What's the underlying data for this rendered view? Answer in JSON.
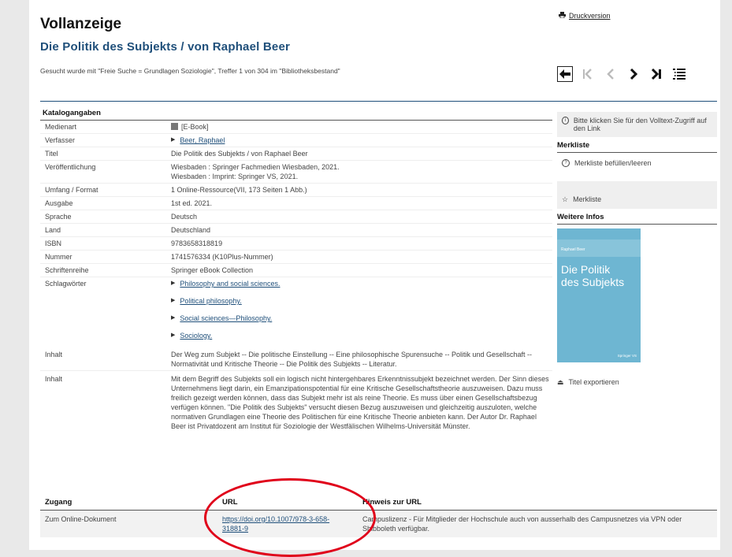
{
  "header": {
    "title": "Vollanzeige",
    "subtitle": "Die Politik des Subjekts / von Raphael Beer",
    "search_info": "Gesucht wurde mit \"Freie Suche = Grundlagen Soziologie\", Treffer 1 von 304 im \"Bibliotheksbestand\"",
    "print_label": "Druckversion"
  },
  "katalog": {
    "heading": "Katalogangaben",
    "rows": [
      {
        "key": "Medienart",
        "value": "[E-Book]"
      },
      {
        "key": "Verfasser",
        "value": "Beer, Raphael"
      },
      {
        "key": "Titel",
        "value": "Die Politik des Subjekts / von Raphael Beer"
      },
      {
        "key": "Veröffentlichung",
        "value": "Wiesbaden : Springer Fachmedien Wiesbaden, 2021.",
        "value2": "Wiesbaden : Imprint: Springer VS, 2021."
      },
      {
        "key": "Umfang / Format",
        "value": "1 Online-Ressource(VII, 173 Seiten 1 Abb.)"
      },
      {
        "key": "Ausgabe",
        "value": "1st ed. 2021."
      },
      {
        "key": "Sprache",
        "value": "Deutsch"
      },
      {
        "key": "Land",
        "value": "Deutschland"
      },
      {
        "key": "ISBN",
        "value": "9783658318819"
      },
      {
        "key": "Nummer",
        "value": "1741576334 (K10Plus-Nummer)"
      },
      {
        "key": "Schriftenreihe",
        "value": "Springer eBook Collection"
      },
      {
        "key": "Schlagwörter"
      }
    ],
    "schlagwoerter": [
      "Philosophy and social sciences.",
      "Political philosophy.",
      "Social sciences—Philosophy.",
      "Sociology."
    ],
    "inhalt_label": "Inhalt",
    "inhalt1": "Der Weg zum Subjekt -- Die politische Einstellung -- Eine philosophische Spurensuche -- Politik und Gesellschaft -- Normativität und Kritische Theorie -- Die Politik des Subjekts -- Literatur.",
    "inhalt2": "Mit dem Begriff des Subjekts soll ein logisch nicht hintergehbares Erkenntnissubjekt bezeichnet werden. Der Sinn dieses Unternehmens liegt darin, ein Emanzipationspotential für eine Kritische Gesellschaftstheorie auszuweisen. Dazu muss freilich gezeigt werden können, dass das Subjekt mehr ist als reine Theorie. Es muss über einen Gesellschaftsbezug verfügen können. \"Die Politik des Subjekts\" versucht diesen Bezug auszuweisen und gleichzeitig auszuloten, welche normativen Grundlagen eine Theorie des Politischen für eine Kritische Theorie anbieten kann. Der Autor Dr. Raphael Beer ist Privatdozent am Institut für Soziologie der Westfälischen Wilhelms-Universität Münster."
  },
  "sidebar": {
    "volltext": "Bitte klicken Sie für den Volltext-Zugriff auf den Link",
    "merkliste_heading": "Merkliste",
    "merkliste_fill": "Merkliste befüllen/leeren",
    "merkliste": "Merkliste",
    "weitere_heading": "Weitere Infos",
    "cover_author": "Raphael Beer",
    "cover_title_line1": "Die Politik",
    "cover_title_line2": "des Subjekts",
    "cover_publisher": "Springer VS",
    "export": "Titel exportieren"
  },
  "zugang": {
    "col1": "Zugang",
    "col2": "URL",
    "col3": "Hinweis zur URL",
    "row_label": "Zum Online-Dokument",
    "url_line1": "https://doi.org/10.1007/978-3-658-",
    "url_line2": "31881-9",
    "hinweis": "Campuslizenz - Für Mitglieder der Hochschule auch von ausserhalb des Campusnetzes via VPN oder Shibboleth verfügbar."
  },
  "colors": {
    "link": "#1f4f7a",
    "annotation": "#e0001a"
  }
}
